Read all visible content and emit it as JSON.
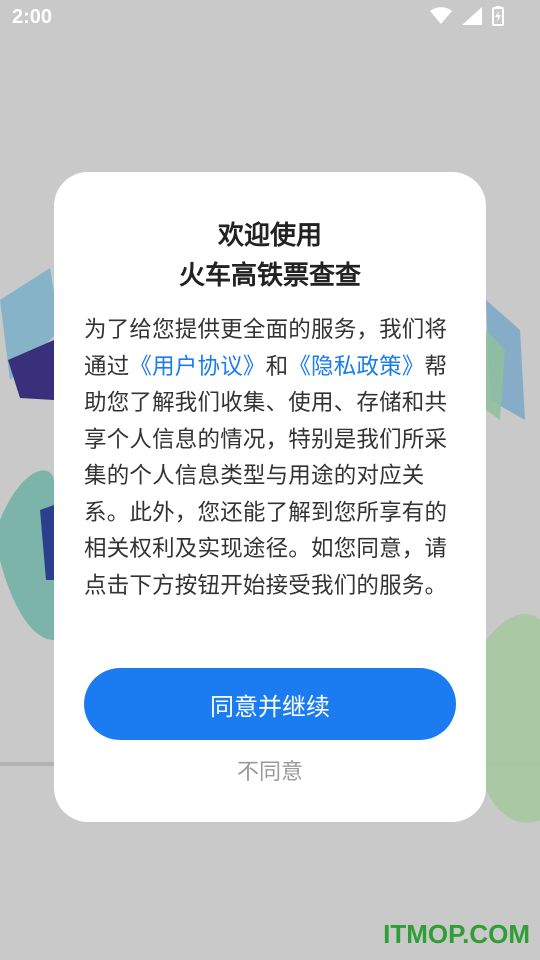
{
  "status_bar": {
    "time": "2:00"
  },
  "dialog": {
    "title_line1": "欢迎使用",
    "title_line2": "火车高铁票查查",
    "body_text1": "为了给您提供更全面的服务，我们将通过",
    "user_agreement_link": "《用户协议》",
    "body_text2": "和",
    "privacy_policy_link": "《隐私政策》",
    "body_text3": "帮助您了解我们收集、使用、存储和共享个人信息的情况，特别是我们所采集的个人信息类型与用途的对应关系。此外，您还能了解到您所享有的相关权利及实现途径。如您同意，请点击下方按钮开始接受我们的服务。",
    "agree_button": "同意并继续",
    "disagree_button": "不同意"
  },
  "watermark": "ITMOP.COM",
  "colors": {
    "accent": "#1a7cf0",
    "background": "#c9c9c9",
    "watermark": "#2f9e34"
  }
}
